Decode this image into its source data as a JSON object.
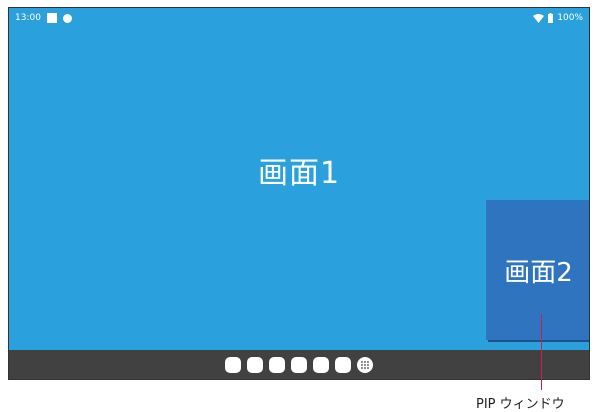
{
  "status_bar": {
    "time": "13:00",
    "battery": "100%",
    "icons": [
      "square-notification-icon",
      "circle-notification-icon",
      "wifi-icon",
      "battery-icon"
    ]
  },
  "main_screen": {
    "label": "画面1"
  },
  "pip_window": {
    "label": "画面2"
  },
  "dock": {
    "apps": [
      "app-1",
      "app-2",
      "app-3",
      "app-4",
      "app-5",
      "app-6"
    ],
    "all_apps": "all-apps-icon"
  },
  "callout": {
    "text": "PIP ウィンドウ",
    "color": "#d11c4e"
  },
  "colors": {
    "screen_bg": "#2aa0dd",
    "pip_bg": "#2f74bf",
    "dock_bg": "#414141"
  }
}
